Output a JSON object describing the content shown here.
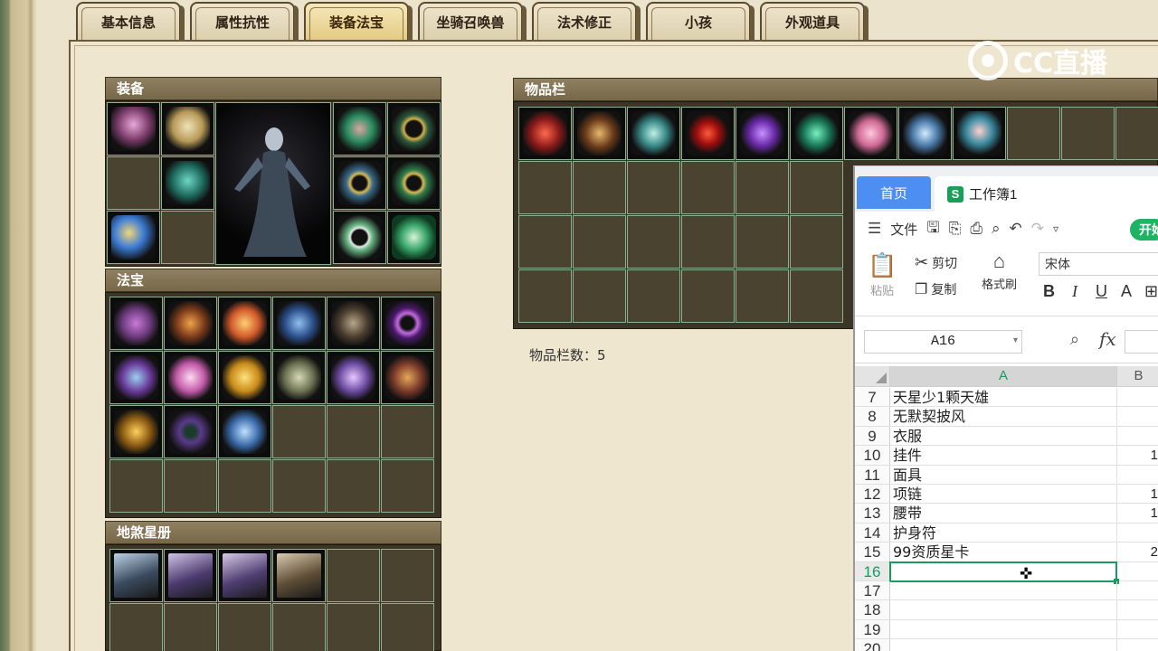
{
  "tabs": [
    {
      "label": "基本信息",
      "active": false
    },
    {
      "label": "属性抗性",
      "active": false
    },
    {
      "label": "装备法宝",
      "active": true
    },
    {
      "label": "坐骑召唤兽",
      "active": false
    },
    {
      "label": "法术修正",
      "active": false
    },
    {
      "label": "小孩",
      "active": false
    },
    {
      "label": "外观道具",
      "active": false
    }
  ],
  "sections": {
    "equipment": "装备",
    "treasure": "法宝",
    "star_book": "地煞星册",
    "inventory": "物品栏"
  },
  "inventory_count_label": "物品栏数：5",
  "watermark": "CC直播",
  "spreadsheet": {
    "home_tab": "首页",
    "doc_tab": "工作簿1",
    "doc_badge": "S",
    "menu_file": "文件",
    "open_button": "开始",
    "paste": "粘贴",
    "cut": "剪切",
    "copy": "复制",
    "format_painter": "格式刷",
    "font_name": "宋体",
    "name_box": "A16",
    "fx": "fx",
    "col_a": "A",
    "col_b": "B",
    "rows": [
      {
        "num": "7",
        "a": "天星少1颗天雄",
        "b": ""
      },
      {
        "num": "8",
        "a": "无默契披风",
        "b": ""
      },
      {
        "num": "9",
        "a": "衣服",
        "b": ""
      },
      {
        "num": "10",
        "a": "挂件",
        "b": "1"
      },
      {
        "num": "11",
        "a": "面具",
        "b": ""
      },
      {
        "num": "12",
        "a": "项链",
        "b": "1"
      },
      {
        "num": "13",
        "a": "腰带",
        "b": "1"
      },
      {
        "num": "14",
        "a": "护身符",
        "b": ""
      },
      {
        "num": "15",
        "a": "99资质星卡",
        "b": "2"
      },
      {
        "num": "16",
        "a": "",
        "b": ""
      },
      {
        "num": "17",
        "a": "",
        "b": ""
      },
      {
        "num": "18",
        "a": "",
        "b": ""
      },
      {
        "num": "19",
        "a": "",
        "b": ""
      },
      {
        "num": "20",
        "a": "",
        "b": ""
      }
    ],
    "selected_row": "16"
  },
  "colors": {
    "accent_green": "#1c9a5e",
    "home_tab_blue": "#4c8ef2",
    "section_header": "#857658"
  }
}
